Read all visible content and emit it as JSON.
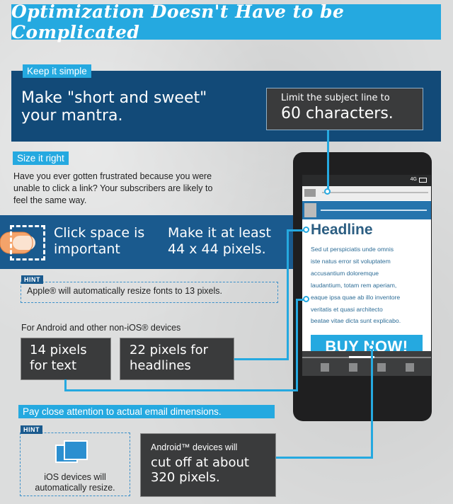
{
  "header": {
    "title": "Optimization Doesn't Have to be Complicated"
  },
  "keep_simple": {
    "tag": "Keep it simple",
    "mantra_line1": "Make \"short and sweet\"",
    "mantra_line2": "your mantra.",
    "subject_line1": "Limit the subject line to",
    "subject_line2": "60 characters."
  },
  "size_right": {
    "tag": "Size it right",
    "intro_line1": "Have you ever gotten frustrated because you were",
    "intro_line2": "unable to click a link? Your subscribers are likely to",
    "intro_line3": "feel the same way.",
    "click_line1": "Click space is",
    "click_line2": "important",
    "size_line1": "Make it at least",
    "size_line2": "44 x 44 pixels.",
    "hint_label": "HINT",
    "hint_text": "Apple® will automatically resize fonts to 13 pixels.",
    "android_label": "For Android and other non-iOS® devices",
    "text_px_line1": "14 pixels",
    "text_px_line2": "for text",
    "headline_px_line1": "22 pixels for",
    "headline_px_line2": "headlines"
  },
  "dimensions": {
    "tag": "Pay close attention to actual email dimensions.",
    "hint_label": "HINT",
    "ios_line1": "iOS devices will",
    "ios_line2": "automatically resize.",
    "android_line1": "Android™ devices will",
    "android_line2": "cut off at about",
    "android_line3": "320 pixels."
  },
  "phone": {
    "status": "4G",
    "headline": "Headline",
    "body_lines": [
      "Sed ut perspiciatis unde omnis",
      "iste natus error sit voluptatem",
      "accusantium doloremque",
      "laudantium, totam rem aperiam,",
      "eaque ipsa quae ab illo inventore",
      "veritatis et quasi architecto",
      "beatae vitae dicta sunt explicabo."
    ],
    "button": "BUY NOW!"
  },
  "colors": {
    "accent": "#25a9e0",
    "navy": "#124a78",
    "dark": "#3a3b3c"
  }
}
